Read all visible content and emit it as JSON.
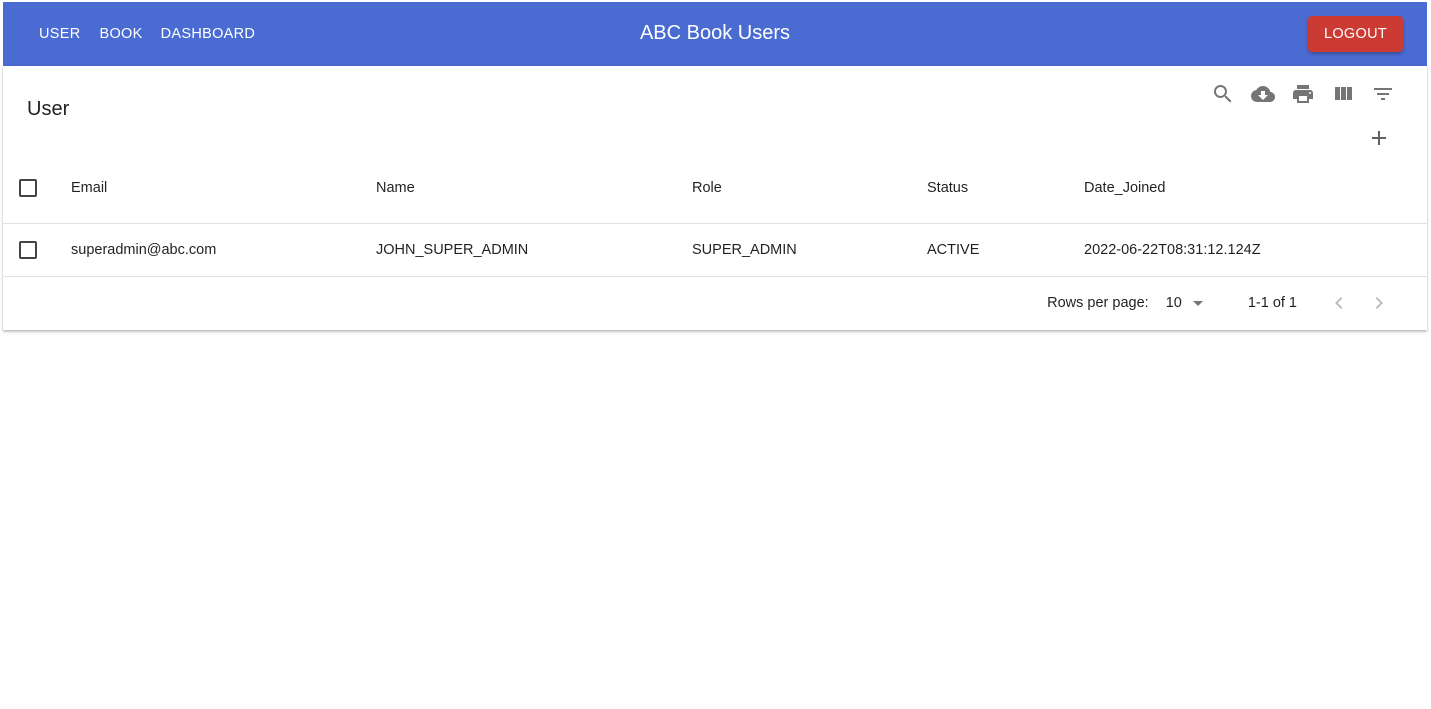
{
  "appbar": {
    "nav_items": [
      {
        "label": "USER"
      },
      {
        "label": "BOOK"
      },
      {
        "label": "DASHBOARD"
      }
    ],
    "title": "ABC Book Users",
    "logout_label": "LOGOUT",
    "background_color": "#4a6bd1",
    "logout_color": "#cc3b33"
  },
  "table": {
    "title": "User",
    "toolbar_icons": [
      "search-icon",
      "download-icon",
      "print-icon",
      "view-columns-icon",
      "filter-icon",
      "add-icon"
    ],
    "columns": [
      "Email",
      "Name",
      "Role",
      "Status",
      "Date_Joined"
    ],
    "rows": [
      {
        "email": "superadmin@abc.com",
        "name": "JOHN_SUPER_ADMIN",
        "role": "SUPER_ADMIN",
        "status": "ACTIVE",
        "date_joined": "2022-06-22T08:31:12.124Z"
      }
    ]
  },
  "pagination": {
    "rows_per_page_label": "Rows per page:",
    "rows_per_page_value": "10",
    "page_info": "1-1 of 1"
  }
}
